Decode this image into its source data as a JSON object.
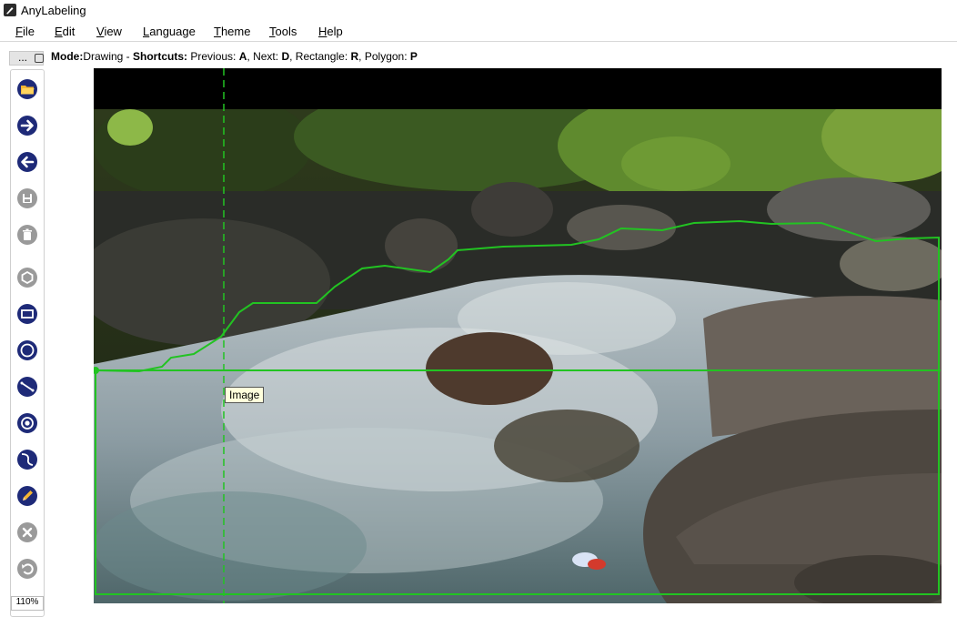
{
  "window": {
    "title": "AnyLabeling"
  },
  "menu": [
    "File",
    "Edit",
    "View",
    "Language",
    "Theme",
    "Tools",
    "Help"
  ],
  "toolbar_header": {
    "dots": "..."
  },
  "mode_bar": {
    "mode_label": "Mode:",
    "mode_value": "Drawing",
    "sep": " - ",
    "shortcuts_label": "Shortcuts:",
    "prev_label": "Previous:",
    "prev_key": "A",
    "next_label": "Next:",
    "next_key": "D",
    "rect_label": "Rectangle:",
    "rect_key": "R",
    "poly_label": "Polygon:",
    "poly_key": "P"
  },
  "tools": [
    {
      "name": "open-folder-icon",
      "color": "#f5a623"
    },
    {
      "name": "next-image-icon",
      "color": "#1e2a78"
    },
    {
      "name": "previous-image-icon",
      "color": "#1e2a78"
    },
    {
      "name": "save-icon",
      "color": "#9a9a9a"
    },
    {
      "name": "delete-file-icon",
      "color": "#9a9a9a"
    },
    {
      "name": "polygon-icon",
      "color": "#9a9a9a"
    },
    {
      "name": "rectangle-icon",
      "color": "#1e2a78"
    },
    {
      "name": "circle-icon",
      "color": "#1e2a78"
    },
    {
      "name": "line-icon",
      "color": "#1e2a78"
    },
    {
      "name": "point-icon",
      "color": "#1e2a78"
    },
    {
      "name": "linestrip-icon",
      "color": "#1e2a78"
    },
    {
      "name": "edit-pencil-icon",
      "color": "#1e2a78"
    },
    {
      "name": "cancel-icon",
      "color": "#9a9a9a"
    },
    {
      "name": "undo-icon",
      "color": "#9a9a9a"
    }
  ],
  "zoom": "110%",
  "tooltip": "Image",
  "colors": {
    "accent": "#1e2a78",
    "annotation": "#00c000"
  }
}
